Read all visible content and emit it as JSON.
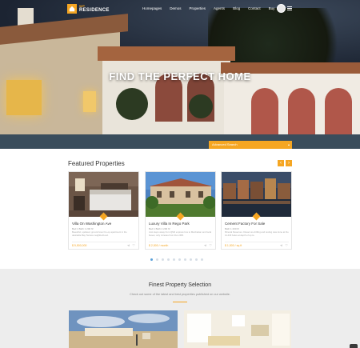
{
  "brand": {
    "line1": "WP",
    "line2": "RESIDENCE"
  },
  "nav": {
    "items": [
      "Homepages",
      "Demos",
      "Properties",
      "Agents",
      "Blog",
      "Contact",
      "Buy"
    ]
  },
  "hero": {
    "title": "FIND THE PERFECT HOME",
    "advanced_search": "Advanced Search"
  },
  "featured": {
    "title": "Featured Properties",
    "prev": "‹",
    "next": "›",
    "cards": [
      {
        "name": "Villa On Washington Ave",
        "meta": "Bed 1   Bath 1   200 ft²",
        "desc": "Beautiful, updated, ground level Co-op apartment in the desirable Bay Terrace neighborhood.",
        "price": "$ 5,500,000"
      },
      {
        "name": "Luxury Villa In Rego Park",
        "meta": "Bed 1   Bath 2   200 ft²",
        "desc": "Just steps away from QM2 express bus to Manhattan and local buses; only minutes from the LIRR.",
        "price": "$ 2,500 / month"
      },
      {
        "name": "Cement Factory For Sale",
        "meta": "Bath 1   200 ft²",
        "desc": "Mineral Reserves. Diesel ore drilling and testing was done at the 11 drill holes at depth of up to.",
        "price": "$ 1,500 / sq ft"
      }
    ],
    "dots": 10,
    "active_dot": 0
  },
  "finest": {
    "title": "Finest Property Selection",
    "subtitle": "Check out some of the latest and best properties published on our website."
  },
  "colors": {
    "accent": "#f5a623"
  }
}
